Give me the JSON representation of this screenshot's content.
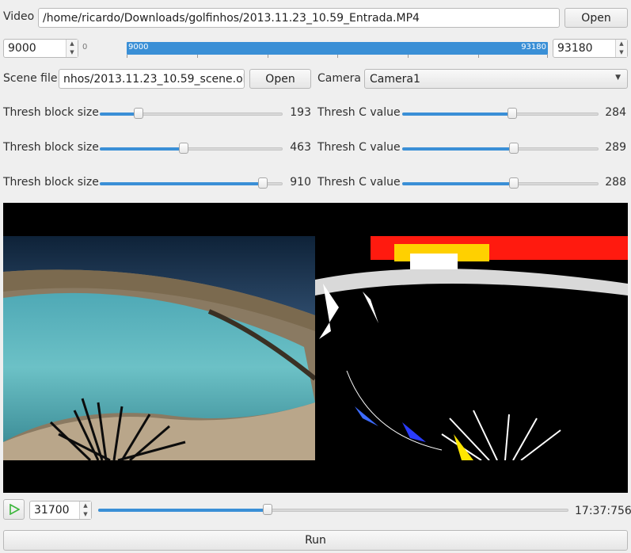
{
  "video": {
    "label": "Video",
    "path": "/home/ricardo/Downloads/golfinhos/2013.11.23_10.59_Entrada.MP4",
    "open_label": "Open"
  },
  "range": {
    "start_value": "9000",
    "min_label": "0",
    "bar_start_label": "9000",
    "bar_end_label": "93180",
    "end_value": "93180"
  },
  "scene": {
    "label": "Scene file",
    "path": "nhos/2013.11.23_10.59_scene.obj",
    "open_label": "Open",
    "camera_label": "Camera",
    "camera_value": "Camera1"
  },
  "thresholds": [
    {
      "block_label": "Thresh block size",
      "block_value": "193",
      "block_fraction": 0.21,
      "c_label": "Thresh C value",
      "c_value": "284",
      "c_fraction": 0.56
    },
    {
      "block_label": "Thresh block size",
      "block_value": "463",
      "block_fraction": 0.46,
      "c_label": "Thresh C value",
      "c_value": "289",
      "c_fraction": 0.57
    },
    {
      "block_label": "Thresh block size",
      "block_value": "910",
      "block_fraction": 0.89,
      "c_label": "Thresh C value",
      "c_value": "288",
      "c_fraction": 0.57
    }
  ],
  "playback": {
    "frame_value": "31700",
    "position_fraction": 0.36,
    "time": "17:37:756"
  },
  "run_label": "Run",
  "icons": {
    "play": "play-icon",
    "dropdown": "chevron-down-icon",
    "spin_up": "spin-up-icon",
    "spin_down": "spin-down-icon"
  },
  "colors": {
    "accent": "#3a8fd6",
    "play_green": "#3bb63b"
  }
}
